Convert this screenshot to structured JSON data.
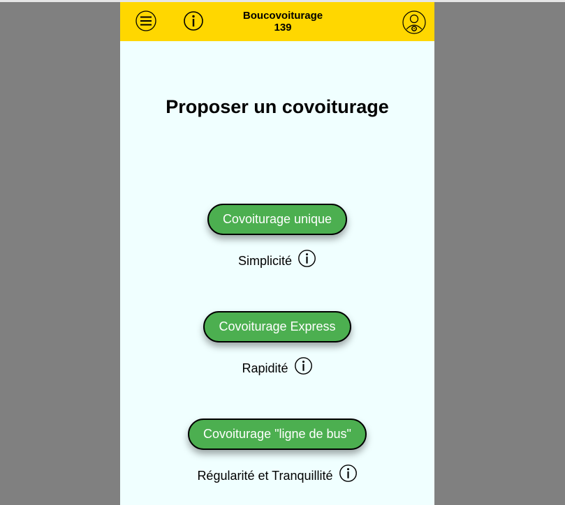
{
  "header": {
    "app_name": "Boucovoiturage",
    "app_number": "139",
    "menu_icon": "hamburger-menu-icon",
    "info_icon": "info-icon",
    "profile_icon": "driver-profile-icon",
    "background_color": "#ffd700"
  },
  "page": {
    "title": "Proposer un covoiturage"
  },
  "options": [
    {
      "button_label": "Covoiturage unique",
      "description": "Simplicité"
    },
    {
      "button_label": "Covoiturage Express",
      "description": "Rapidité"
    },
    {
      "button_label": "Covoiturage \"ligne de bus\"",
      "description": "Régularité et Tranquillité"
    }
  ],
  "colors": {
    "button_green": "#4caf50",
    "content_background": "#f0ffff",
    "outer_background": "#808080"
  }
}
